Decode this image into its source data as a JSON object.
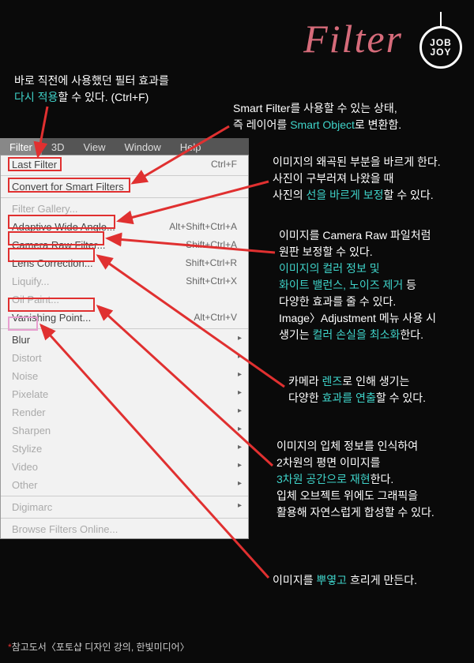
{
  "header": {
    "title": "Filter",
    "logo_line1": "JOB",
    "logo_line2": "JOY"
  },
  "annotations": {
    "last_filter_pre": "바로 직전에 사용했던 필터 효과를",
    "last_filter_hl": "다시 적용",
    "last_filter_post": "할 수 있다. (Ctrl+F)",
    "smart_pre": "Smart Filter를 사용할 수 있는 상태,",
    "smart_line2a": "즉 레이어를 ",
    "smart_hl": "Smart Object",
    "smart_line2b": "로 변환함.",
    "awa_l1": "이미지의 왜곡된 부분을 바르게 한다.",
    "awa_l2": "사진이 구부러져 나왔을 때",
    "awa_l3a": "사진의 ",
    "awa_l3_hl": "선을 바르게 보정",
    "awa_l3b": "할 수 있다.",
    "craw_l1": "이미지를 Camera Raw 파일처럼",
    "craw_l2": "원판 보정할 수 있다.",
    "craw_l3_hl": "이미지의 컬러 정보 및",
    "craw_l4_hl": "화이트 밸런스, 노이즈 제거",
    "craw_l4b": " 등",
    "craw_l5": "다양한 효과를 줄 수 있다.",
    "craw_l6": "Image〉Adjustment 메뉴 사용 시",
    "craw_l7a": "생기는 ",
    "craw_l7_hl": "컬러 손실을 최소화",
    "craw_l7b": "한다.",
    "lens_l1a": "카메라 ",
    "lens_l1_hl": "렌즈",
    "lens_l1b": "로 인해 생기는",
    "lens_l2a": "다양한 ",
    "lens_l2_hl": "효과를 연출",
    "lens_l2b": "할 수 있다.",
    "vp_l1": "이미지의 입체 정보를 인식하여",
    "vp_l2": "2차원의 평면 이미지를",
    "vp_l3_hl": "3차원 공간으로 재현",
    "vp_l3b": "한다.",
    "vp_l4": "입체 오브젝트 위에도 그래픽을",
    "vp_l5": "활용해 자연스럽게 합성할 수 있다.",
    "blur_a": "이미지를 ",
    "blur_hl": "뿌옇고",
    "blur_b": " 흐리게 만든다."
  },
  "menubar": {
    "items": [
      "Filter",
      "3D",
      "View",
      "Window",
      "Help"
    ]
  },
  "menu": {
    "last_filter": {
      "label": "Last Filter",
      "shortcut": "Ctrl+F"
    },
    "convert": {
      "label": "Convert for Smart Filters"
    },
    "gallery": {
      "label": "Filter Gallery..."
    },
    "awa": {
      "label": "Adaptive Wide Angle...",
      "shortcut": "Alt+Shift+Ctrl+A"
    },
    "craw": {
      "label": "Camera Raw Filter...",
      "shortcut": "Shift+Ctrl+A"
    },
    "lens": {
      "label": "Lens Correction...",
      "shortcut": "Shift+Ctrl+R"
    },
    "liquify": {
      "label": "Liquify...",
      "shortcut": "Shift+Ctrl+X"
    },
    "oil": {
      "label": "Oil Paint..."
    },
    "vp": {
      "label": "Vanishing Point...",
      "shortcut": "Alt+Ctrl+V"
    },
    "blur": {
      "label": "Blur"
    },
    "distort": {
      "label": "Distort"
    },
    "noise": {
      "label": "Noise"
    },
    "pixelate": {
      "label": "Pixelate"
    },
    "render": {
      "label": "Render"
    },
    "sharpen": {
      "label": "Sharpen"
    },
    "stylize": {
      "label": "Stylize"
    },
    "video": {
      "label": "Video"
    },
    "other": {
      "label": "Other"
    },
    "digimarc": {
      "label": "Digimarc"
    },
    "browse": {
      "label": "Browse Filters Online..."
    }
  },
  "reference": {
    "star": "*",
    "text": "참고도서〈포토샵 디자인 강의, 한빛미디어〉"
  }
}
